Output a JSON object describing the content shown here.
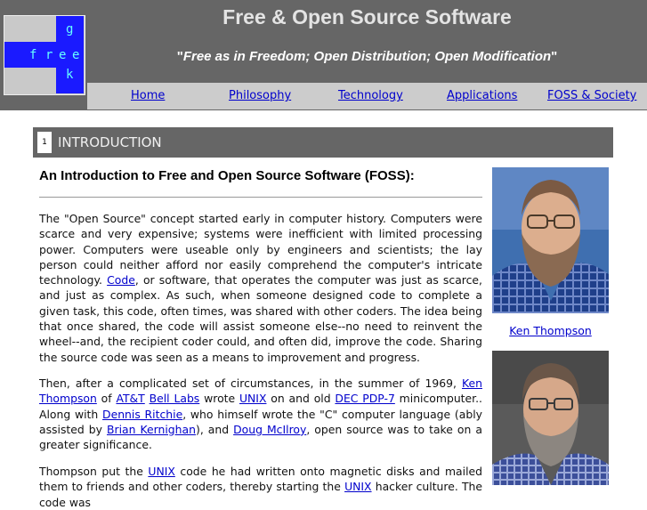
{
  "header": {
    "site_title": "Free & Open Source Software",
    "tagline_open": "\"",
    "tagline": "Free as in Freedom; Open Distribution; Open Modification",
    "tagline_close": "\"",
    "logo_letters": {
      "f": "f",
      "r": "r",
      "e1": "e",
      "e2": "e",
      "g": "g",
      "k": "k"
    }
  },
  "nav": {
    "home": "Home",
    "philosophy": "Philosophy",
    "technology": "Technology",
    "applications": "Applications",
    "society": "FOSS & Society"
  },
  "section": {
    "number": "1",
    "title": "INTRODUCTION"
  },
  "article": {
    "heading": "An Introduction to Free and Open Source Software (FOSS):",
    "p1": {
      "t1": "The \"Open Source\" concept started early in computer history. Computers were scarce and very expensive; systems were inefficient with limited processing power. Computers were useable only by engineers and scientists; the lay person could neither afford nor easily comprehend the computer's intricate technology. ",
      "link_code": "Code",
      "t2": ", or software, that operates the computer was just as scarce, and just as complex. As such, when someone designed code to complete a given task, this code, often times, was shared with other coders. The idea being that once shared, the code will assist someone else--no need to reinvent the wheel--and, the recipient coder could, and often did, improve the code. Sharing the source code was seen as a means to improvement and progress."
    },
    "p2": {
      "t1": "Then, after a complicated set of circumstances, in the summer of 1969, ",
      "link_ken": "Ken Thompson",
      "t2": " of ",
      "link_att": "AT&T",
      "t3": " ",
      "link_bell": "Bell Labs",
      "t4": " wrote ",
      "link_unix": "UNIX",
      "t5": " on and old ",
      "link_dec": "DEC PDP-7",
      "t6": " minicomputer.. Along with ",
      "link_dennis": "Dennis Ritchie",
      "t7": ", who himself wrote the \"C\" computer language (ably assisted by ",
      "link_brian": "Brian Kernighan",
      "t8": "), and ",
      "link_doug": "Doug McIlroy",
      "t9": ", open source was to take on a greater significance."
    },
    "p3": {
      "t1": "Thompson put the ",
      "link_unix": "UNIX",
      "t2": " code he had written onto magnetic disks and mailed them to friends and other coders, thereby starting the ",
      "link_unix2": "UNIX",
      "t3": " hacker culture. The code was"
    }
  },
  "sidebar": {
    "caption_1": "Ken Thompson"
  },
  "colors": {
    "header_bg": "#666666",
    "nav_bg": "#cccccc",
    "link": "#0000cc",
    "logo_blue": "#1a1aff"
  }
}
